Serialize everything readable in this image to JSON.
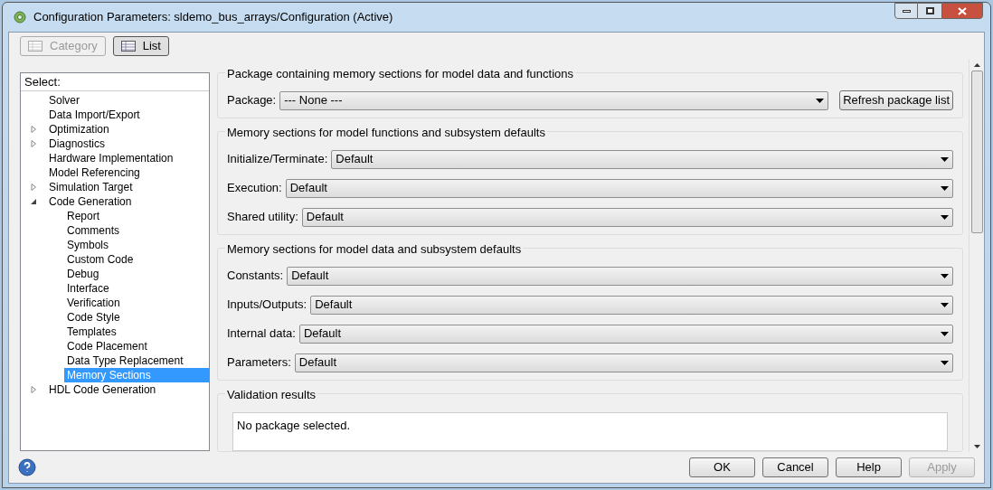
{
  "window": {
    "title": "Configuration Parameters: sldemo_bus_arrays/Configuration (Active)"
  },
  "view_buttons": [
    {
      "label": "Category",
      "selected": false,
      "disabled": true
    },
    {
      "label": "List",
      "selected": true,
      "disabled": false
    }
  ],
  "tree": {
    "header": "Select:",
    "items": [
      {
        "label": "Solver",
        "selected": false
      },
      {
        "label": "Data Import/Export",
        "selected": false
      },
      {
        "label": "Optimization",
        "selected": false,
        "expanded": false
      },
      {
        "label": "Diagnostics",
        "selected": false,
        "expanded": false
      },
      {
        "label": "Hardware Implementation",
        "selected": false
      },
      {
        "label": "Model Referencing",
        "selected": false
      },
      {
        "label": "Simulation Target",
        "selected": false,
        "expanded": false
      },
      {
        "label": "Code Generation",
        "selected": false,
        "expanded": true,
        "children": [
          {
            "label": "Report",
            "selected": false
          },
          {
            "label": "Comments",
            "selected": false
          },
          {
            "label": "Symbols",
            "selected": false
          },
          {
            "label": "Custom Code",
            "selected": false
          },
          {
            "label": "Debug",
            "selected": false
          },
          {
            "label": "Interface",
            "selected": false
          },
          {
            "label": "Verification",
            "selected": false
          },
          {
            "label": "Code Style",
            "selected": false
          },
          {
            "label": "Templates",
            "selected": false
          },
          {
            "label": "Code Placement",
            "selected": false
          },
          {
            "label": "Data Type Replacement",
            "selected": false
          },
          {
            "label": "Memory Sections",
            "selected": true
          }
        ]
      },
      {
        "label": "HDL Code Generation",
        "selected": false,
        "expanded": false
      }
    ]
  },
  "sections": [
    {
      "title": "Package containing memory sections for model data and functions",
      "fields": [
        {
          "label": "Package:",
          "value": "--- None ---"
        }
      ],
      "button": "Refresh package list"
    },
    {
      "title": "Memory sections for model functions and subsystem defaults",
      "fields": [
        {
          "label": "Initialize/Terminate:",
          "value": "Default"
        },
        {
          "label": "Execution:",
          "value": "Default"
        },
        {
          "label": "Shared utility:",
          "value": "Default"
        }
      ]
    },
    {
      "title": "Memory sections for model data and subsystem defaults",
      "fields": [
        {
          "label": "Constants:",
          "value": "Default"
        },
        {
          "label": "Inputs/Outputs:",
          "value": "Default"
        },
        {
          "label": "Internal data:",
          "value": "Default"
        },
        {
          "label": "Parameters:",
          "value": "Default"
        }
      ]
    }
  ],
  "validation": {
    "title": "Validation results",
    "text": "No package selected."
  },
  "footer_buttons": [
    {
      "label": "OK",
      "disabled": false
    },
    {
      "label": "Cancel",
      "disabled": false
    },
    {
      "label": "Help",
      "disabled": false
    },
    {
      "label": "Apply",
      "disabled": true
    }
  ]
}
